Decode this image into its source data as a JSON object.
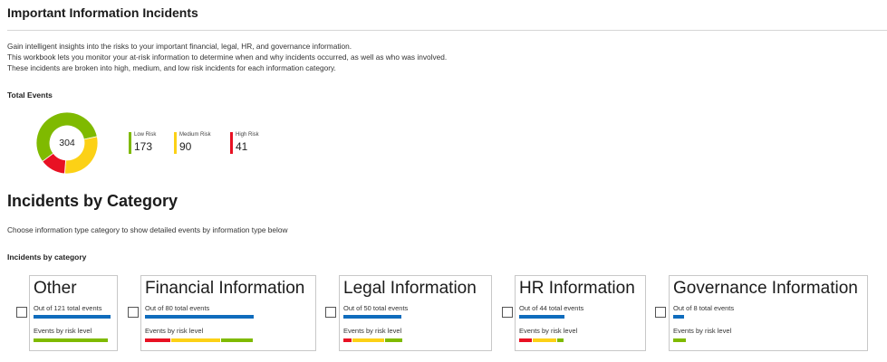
{
  "header": {
    "title": "Important Information Incidents"
  },
  "description": [
    "Gain intelligent insights into the risks to your important financial, legal, HR, and governance information.",
    "This workbook lets you monitor your at-risk information to determine when and why incidents occurred, as well as who was involved.",
    "These incidents are broken into high, medium, and low risk incidents for each information category."
  ],
  "total_events": {
    "label": "Total Events",
    "total": "304",
    "legend": [
      {
        "label": "Low Risk",
        "value": "173",
        "color": "#7fba00"
      },
      {
        "label": "Medium Risk",
        "value": "90",
        "color": "#fcd116"
      },
      {
        "label": "High Risk",
        "value": "41",
        "color": "#e81123"
      }
    ]
  },
  "chart_data": {
    "type": "pie",
    "variant": "donut",
    "center_label": "304",
    "categories": [
      "Low Risk",
      "Medium Risk",
      "High Risk"
    ],
    "values": [
      173,
      90,
      41
    ],
    "colors": [
      "#7fba00",
      "#fcd116",
      "#e81123"
    ],
    "legend_placement": "right"
  },
  "category_section": {
    "heading": "Incidents by Category",
    "description": "Choose information type category to show detailed events by information type below",
    "subheading": "Incidents by category"
  },
  "categories": [
    {
      "title": "Other",
      "total_text": "Out of 121 total events",
      "risk_label": "Events by risk level",
      "total": 121,
      "risk": {
        "high": 0,
        "medium": 0,
        "low": 1
      }
    },
    {
      "title": "Financial Information",
      "total_text": "Out of 80 total events",
      "risk_label": "Events by risk level",
      "total": 80,
      "risk": {
        "high": 0.24,
        "medium": 0.46,
        "low": 0.3
      }
    },
    {
      "title": "Legal Information",
      "total_text": "Out of 50 total events",
      "risk_label": "Events by risk level",
      "total": 50,
      "risk": {
        "high": 0.14,
        "medium": 0.56,
        "low": 0.3
      }
    },
    {
      "title": "HR Information",
      "total_text": "Out of 44 total events",
      "risk_label": "Events by risk level",
      "total": 44,
      "risk": {
        "high": 0.3,
        "medium": 0.55,
        "low": 0.15
      }
    },
    {
      "title": "Governance Information",
      "total_text": "Out of 8 total events",
      "risk_label": "Events by risk level",
      "total": 8,
      "risk": {
        "high": 0,
        "medium": 0,
        "low": 1
      }
    }
  ],
  "colors": {
    "accent": "#0f6cbd",
    "low": "#7fba00",
    "medium": "#fcd116",
    "high": "#e81123"
  }
}
